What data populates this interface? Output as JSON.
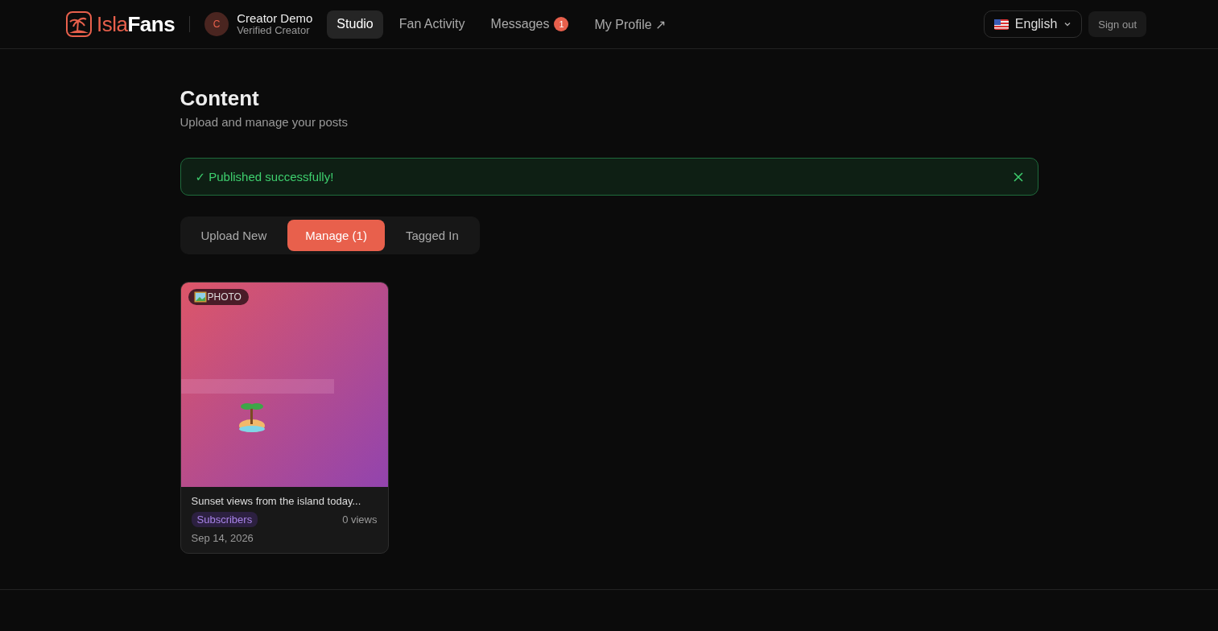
{
  "header": {
    "brand": {
      "first": "Isla",
      "second": "Fans"
    },
    "user": {
      "initial": "C",
      "name": "Creator Demo",
      "role": "Verified Creator"
    },
    "nav": [
      {
        "label": "Studio",
        "selected": true
      },
      {
        "label": "Fan Activity",
        "selected": false
      },
      {
        "label": "Messages",
        "selected": false,
        "badge": "1"
      },
      {
        "label": "My Profile ↗",
        "selected": false
      }
    ],
    "language": {
      "label": "English"
    },
    "sign_out": "Sign out"
  },
  "page": {
    "title": "Content",
    "subtitle": "Upload and manage your posts"
  },
  "alert": {
    "text": "✓ Published successfully!"
  },
  "tabs": [
    {
      "label": "Upload New",
      "selected": false
    },
    {
      "label": "Manage (1)",
      "selected": true
    },
    {
      "label": "Tagged In",
      "selected": false
    }
  ],
  "posts": [
    {
      "media_type": "PHOTO",
      "caption": "Sunset views from the island today...",
      "visibility": "Subscribers",
      "views": "0 views",
      "date": "Sep 14, 2026"
    }
  ]
}
